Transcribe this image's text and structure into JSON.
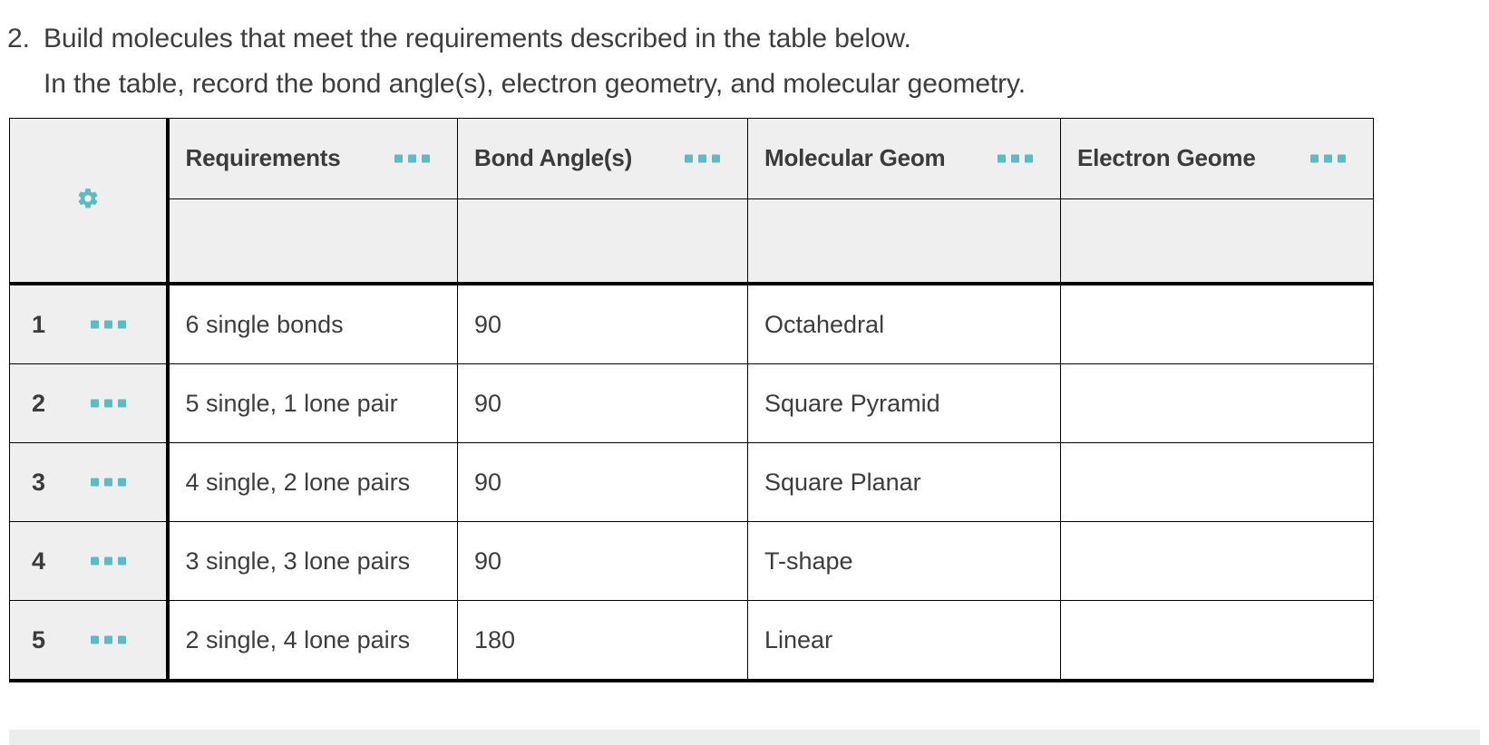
{
  "question": {
    "number": "2.",
    "line1": "Build molecules that meet the requirements described in the table below.",
    "line2": "In the table, record the bond angle(s), electron geometry, and molecular geometry."
  },
  "theme": {
    "accent": "#5bbcc1",
    "header_bg": "#efefef",
    "body_bg": "#ffffff",
    "border": "#000000",
    "text": "#3d3d3d",
    "bottom_band": "#ededed"
  },
  "table": {
    "corner_icon": "gear-icon",
    "menu_icon": "ellipsis-icon",
    "columns": [
      {
        "label": "Requirements",
        "menu": "•••"
      },
      {
        "label": "Bond Angle(s)",
        "menu": "•••"
      },
      {
        "label": "Molecular Geom",
        "menu": "•••"
      },
      {
        "label": "Electron Geome",
        "menu": "•••"
      }
    ],
    "subheader": [
      "",
      "",
      "",
      ""
    ],
    "rows": [
      {
        "num": "1",
        "requirements": "6 single bonds",
        "bond_angle": "90",
        "molecular_geometry": "Octahedral",
        "electron_geometry": ""
      },
      {
        "num": "2",
        "requirements": "5 single, 1 lone pair",
        "bond_angle": "90",
        "molecular_geometry": "Square Pyramid",
        "electron_geometry": ""
      },
      {
        "num": "3",
        "requirements": "4 single, 2 lone pairs",
        "bond_angle": "90",
        "molecular_geometry": "Square Planar",
        "electron_geometry": ""
      },
      {
        "num": "4",
        "requirements": "3 single, 3 lone pairs",
        "bond_angle": "90",
        "molecular_geometry": "T-shape",
        "electron_geometry": ""
      },
      {
        "num": "5",
        "requirements": "2 single, 4 lone pairs",
        "bond_angle": "180",
        "molecular_geometry": "Linear",
        "electron_geometry": ""
      }
    ]
  }
}
